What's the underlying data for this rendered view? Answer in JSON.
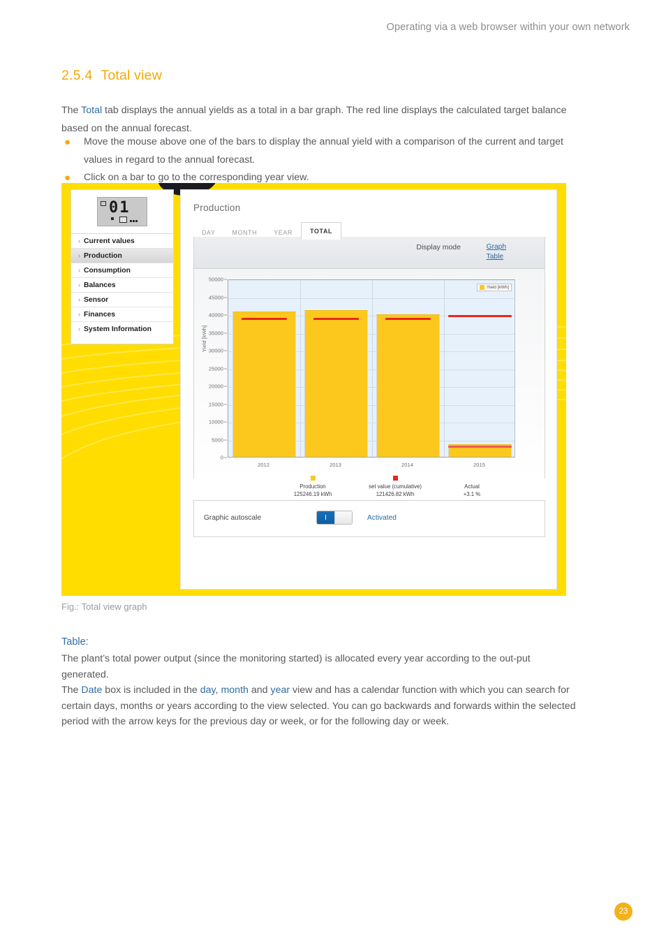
{
  "header": {
    "running_head": "Operating via a web browser within your own network"
  },
  "section": {
    "number": "2.5.4",
    "title": "Total view"
  },
  "intro": {
    "p1_a": "The ",
    "p1_link": "Total",
    "p1_b": " tab displays the annual yields as a total in a bar graph. The red line displays the calculated target balance based on the annual forecast.",
    "bullets": [
      "Move the mouse above one of the bars to display the annual yield with a comparison of the current and target values in regard to the annual forecast.",
      "Click on a bar to go to the corresponding year view."
    ],
    "bullet_glyph": "●"
  },
  "screenshot": {
    "device": {
      "lcd_value": "01"
    },
    "sidebar": {
      "chevron": "›",
      "items": [
        {
          "label": "Current values",
          "active": false
        },
        {
          "label": "Production",
          "active": true
        },
        {
          "label": "Consumption",
          "active": false
        },
        {
          "label": "Balances",
          "active": false
        },
        {
          "label": "Sensor",
          "active": false
        },
        {
          "label": "Finances",
          "active": false
        },
        {
          "label": "System Information",
          "active": false
        }
      ]
    },
    "content": {
      "title": "Production",
      "tabs": [
        {
          "label": "DAY",
          "active": false
        },
        {
          "label": "MONTH",
          "active": false
        },
        {
          "label": "YEAR",
          "active": false
        },
        {
          "label": "TOTAL",
          "active": true
        }
      ],
      "display_mode": {
        "label": "Display mode",
        "options": [
          "Graph",
          "Table"
        ]
      },
      "autoscale": {
        "label": "Graphic autoscale",
        "toggle_on_glyph": "I",
        "state": "Activated"
      }
    }
  },
  "chart_data": {
    "type": "bar",
    "title": "",
    "xlabel": "",
    "ylabel": "Yield [kWh]",
    "ylim": [
      0,
      50000
    ],
    "yticks": [
      0,
      5000,
      10000,
      15000,
      20000,
      25000,
      30000,
      35000,
      40000,
      45000,
      50000
    ],
    "categories": [
      "2012",
      "2013",
      "2014",
      "2015"
    ],
    "grid": true,
    "legend_position": "top-right",
    "legend": [
      "Yield [kWh]"
    ],
    "series": [
      {
        "name": "Yield [kWh]",
        "color": "#FCC81E",
        "values": [
          40700,
          41100,
          40100,
          3500
        ]
      },
      {
        "name": "set value (cumulative)",
        "color": "#E8271B",
        "values": [
          39400,
          39400,
          39400,
          40100
        ],
        "style": "target-line"
      }
    ],
    "target_line_2015_low": 3500,
    "footer_legend": [
      {
        "swatch": "#FCC81E",
        "name": "Production",
        "value": "125246.19 kWh"
      },
      {
        "swatch": "#E8271B",
        "name": "set value (cumulative)",
        "value": "121426.82 kWh"
      },
      {
        "swatch": "",
        "name": "Actual",
        "value": "+3.1 %"
      }
    ]
  },
  "caption": "Fig.: Total view graph",
  "table_section": {
    "heading": "Table:",
    "p1": "The plant’s total power output (since the monitoring started) is allocated every year according to the out-put generated.",
    "p2_a": "The ",
    "p2_l1": "Date",
    "p2_b": " box is included in the ",
    "p2_l2": "day",
    "p2_c": ",  ",
    "p2_l3": "month",
    "p2_d": " and ",
    "p2_l4": "year",
    "p2_e": " view and has a calendar function with which you can search for certain days, months or years according to the view selected. You can go backwards and forwards within the selected period with the arrow keys for the previous day or week, or for the following day or week."
  },
  "page_number": "23",
  "colors": {
    "brand_yellow": "#FFDD00",
    "accent_orange": "#F5A800",
    "link_blue": "#2f6da8",
    "bar_yellow": "#FCC81E",
    "target_red": "#E8271B"
  }
}
